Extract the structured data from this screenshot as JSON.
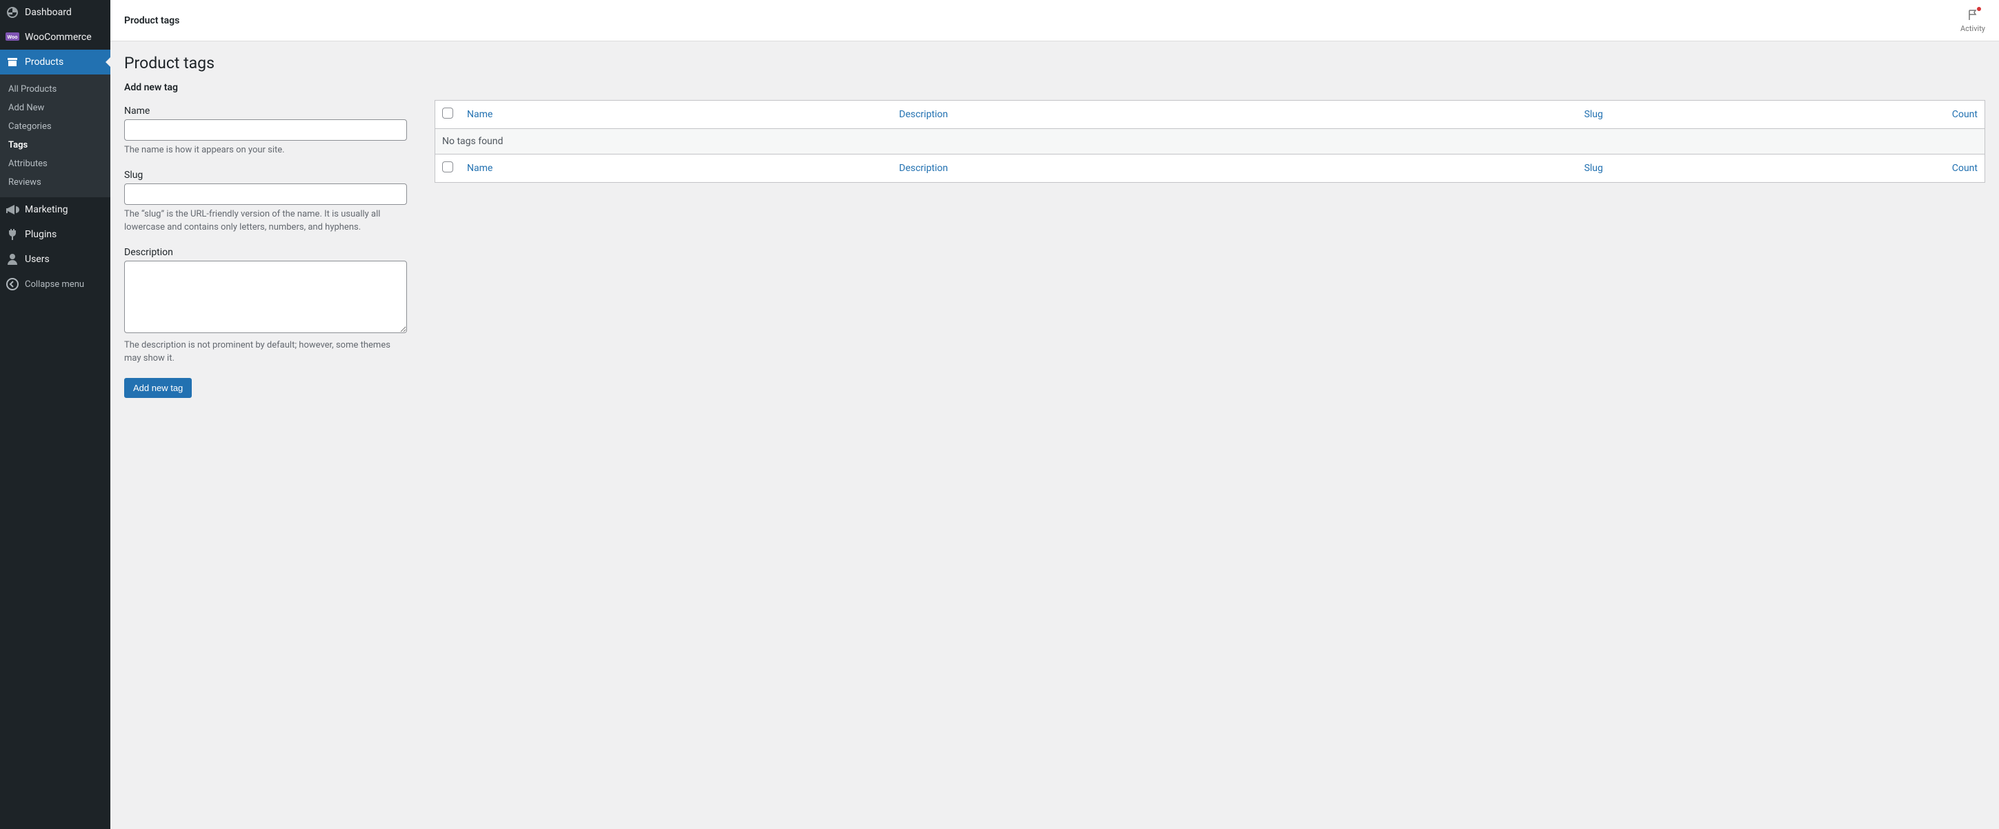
{
  "sidebar": {
    "dashboard": "Dashboard",
    "woocommerce": "WooCommerce",
    "products": "Products",
    "submenu": {
      "all_products": "All Products",
      "add_new": "Add New",
      "categories": "Categories",
      "tags": "Tags",
      "attributes": "Attributes",
      "reviews": "Reviews"
    },
    "marketing": "Marketing",
    "plugins": "Plugins",
    "users": "Users",
    "collapse": "Collapse menu"
  },
  "topbar": {
    "title": "Product tags",
    "activity": "Activity"
  },
  "page": {
    "heading": "Product tags"
  },
  "form": {
    "section_title": "Add new tag",
    "name": {
      "label": "Name",
      "value": "",
      "help": "The name is how it appears on your site."
    },
    "slug": {
      "label": "Slug",
      "value": "",
      "help": "The “slug” is the URL-friendly version of the name. It is usually all lowercase and contains only letters, numbers, and hyphens."
    },
    "description": {
      "label": "Description",
      "value": "",
      "help": "The description is not prominent by default; however, some themes may show it."
    },
    "submit": "Add new tag"
  },
  "table": {
    "columns": {
      "name": "Name",
      "description": "Description",
      "slug": "Slug",
      "count": "Count"
    },
    "empty": "No tags found"
  }
}
